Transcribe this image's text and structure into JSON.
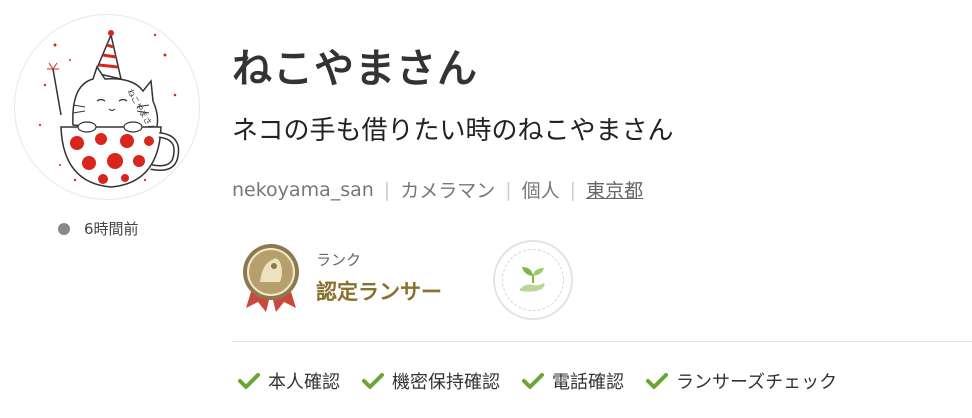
{
  "profile": {
    "display_name": "ねこやまさん",
    "catchphrase": "ネコの手も借りたい時のねこやまさん",
    "avatar_alt": "ねこやまさん",
    "last_seen": "6時間前",
    "username": "nekoyama_san",
    "occupation": "カメラマン",
    "type": "個人",
    "location": "東京都"
  },
  "rank": {
    "label": "ランク",
    "value": "認定ランサー"
  },
  "verifications": [
    {
      "label": "本人確認"
    },
    {
      "label": "機密保持確認"
    },
    {
      "label": "電話確認"
    },
    {
      "label": "ランサーズチェック"
    }
  ],
  "colors": {
    "rank_gold": "#8a6f2d",
    "check_green": "#6aa633",
    "status_dot": "#888888",
    "cup_red": "#d9261c"
  },
  "icons": {
    "status": "status-dot-icon",
    "rank_badge": "medal-badge-icon",
    "sprout": "sprout-icon",
    "check": "check-icon"
  }
}
